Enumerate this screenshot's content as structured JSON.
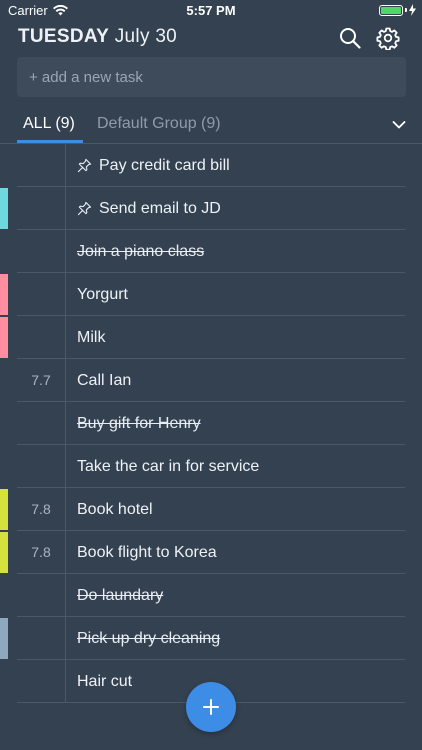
{
  "status_bar": {
    "carrier": "Carrier",
    "time": "5:57 PM",
    "battery_color": "#4cd964"
  },
  "header": {
    "day": "TUESDAY",
    "date": "July 30",
    "icons": [
      "search-icon",
      "gear-icon"
    ]
  },
  "add_task": {
    "placeholder": "+ add a new task",
    "value": ""
  },
  "tabs": {
    "all_label": "ALL (9)",
    "default_label": "Default Group (9)",
    "active": "ALL (9)",
    "accent_color": "#3d8ce6"
  },
  "tasks": [
    {
      "label": "Pay credit card bill",
      "number": "",
      "pinned": true,
      "done": false,
      "color": ""
    },
    {
      "label": "Send email to JD",
      "number": "",
      "pinned": true,
      "done": false,
      "color": "#6fd8de"
    },
    {
      "label": "Join a piano class",
      "number": "",
      "pinned": false,
      "done": true,
      "color": ""
    },
    {
      "label": "Yorgurt",
      "number": "",
      "pinned": false,
      "done": false,
      "color": "#ff8fa0"
    },
    {
      "label": "Milk",
      "number": "",
      "pinned": false,
      "done": false,
      "color": "#ff8fa0"
    },
    {
      "label": "Call Ian",
      "number": "7.7",
      "pinned": false,
      "done": false,
      "color": ""
    },
    {
      "label": "Buy gift for Henry",
      "number": "",
      "pinned": false,
      "done": true,
      "color": ""
    },
    {
      "label": "Take the car in for service",
      "number": "",
      "pinned": false,
      "done": false,
      "color": ""
    },
    {
      "label": "Book hotel",
      "number": "7.8",
      "pinned": false,
      "done": false,
      "color": "#d6e23c"
    },
    {
      "label": "Book flight to Korea",
      "number": "7.8",
      "pinned": false,
      "done": false,
      "color": "#d6e23c"
    },
    {
      "label": "Do laundary",
      "number": "",
      "pinned": false,
      "done": true,
      "color": ""
    },
    {
      "label": "Pick up dry cleaning",
      "number": "",
      "pinned": false,
      "done": true,
      "color": "#8fa8bd"
    },
    {
      "label": "Hair cut",
      "number": "",
      "pinned": false,
      "done": false,
      "color": ""
    }
  ],
  "fab": {
    "icon": "plus-icon",
    "color": "#3d8ce6"
  }
}
